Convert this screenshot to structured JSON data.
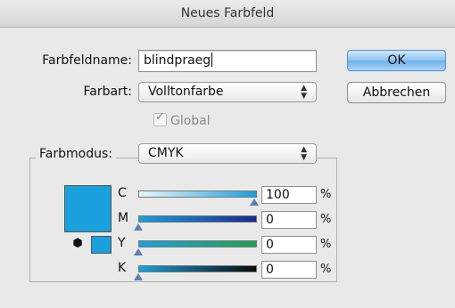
{
  "window": {
    "title": "Neues Farbfeld"
  },
  "form": {
    "name_label": "Farbfeldname:",
    "name_value": "blindpraeg",
    "type_label": "Farbart:",
    "type_value": "Volltonfarbe",
    "global_label": "Global",
    "global_checked": true
  },
  "buttons": {
    "ok": "OK",
    "cancel": "Abbrechen"
  },
  "mode": {
    "label": "Farbmodus:",
    "value": "CMYK"
  },
  "channels": [
    {
      "label": "C",
      "value": "100",
      "unit": "%"
    },
    {
      "label": "M",
      "value": "0",
      "unit": "%"
    },
    {
      "label": "Y",
      "value": "0",
      "unit": "%"
    },
    {
      "label": "K",
      "value": "0",
      "unit": "%"
    }
  ],
  "colors": {
    "swatch": "#1aa0dc",
    "cyan_track_start": "#e8f7fd",
    "cyan_track_end": "#1aa0dc",
    "magenta_track_start": "#1aa0dc",
    "magenta_track_end": "#1b2a8e",
    "yellow_track_start": "#1aa0dc",
    "yellow_track_end": "#23a050",
    "key_track_start": "#1aa0dc",
    "key_track_end": "#0a0a0a"
  }
}
